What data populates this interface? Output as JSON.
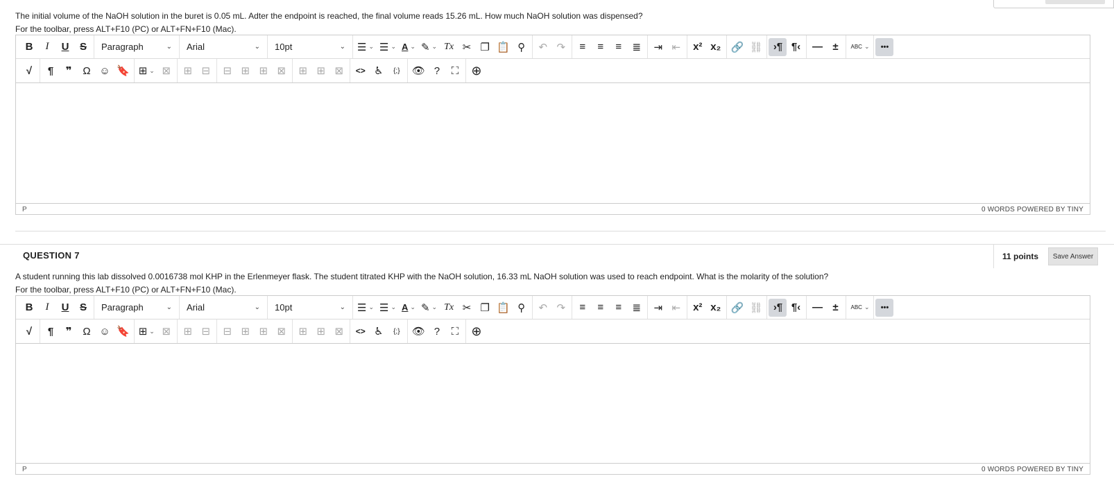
{
  "question6": {
    "text": "The initial volume of the NaOH solution in the buret is 0.05 mL. Adter the endpoint is reached, the final volume reads 15.26 mL. How much NaOH solution was dispensed?",
    "hint": "For the toolbar, press ALT+F10 (PC) or ALT+FN+F10 (Mac).",
    "editor": {
      "block_format": "Paragraph",
      "font_family": "Arial",
      "font_size": "10pt",
      "path": "P",
      "status_right": "0 WORDS  POWERED BY TINY"
    }
  },
  "question7": {
    "title": "QUESTION 7",
    "points": "11 points",
    "save_label": "Save Answer",
    "text": "A student running this lab dissolved 0.0016738 mol KHP in the Erlenmeyer flask. The student titrated KHP with the NaOH solution,  16.33 mL NaOH solution was used to reach endpoint. What is the molarity of the solution?",
    "hint": "For the toolbar, press ALT+F10 (PC) or ALT+FN+F10 (Mac).",
    "editor": {
      "block_format": "Paragraph",
      "font_family": "Arial",
      "font_size": "10pt",
      "path": "P",
      "status_right": "0 WORDS  POWERED BY TINY"
    }
  },
  "toolbar": {
    "bold": "B",
    "italic": "I",
    "underline": "U",
    "strike": "S",
    "superscript": "x²",
    "subscript": "x₂",
    "pilcrow": "¶",
    "quote": "❞",
    "omega": "Ω",
    "code": "<>",
    "curly": "{;}",
    "font_color": "A",
    "clear_format": "Tx",
    "spell": "ABC",
    "more": "•••"
  },
  "colors": {
    "accent_active": "#d4d7dc",
    "border": "#cccccc",
    "text": "#222222"
  }
}
